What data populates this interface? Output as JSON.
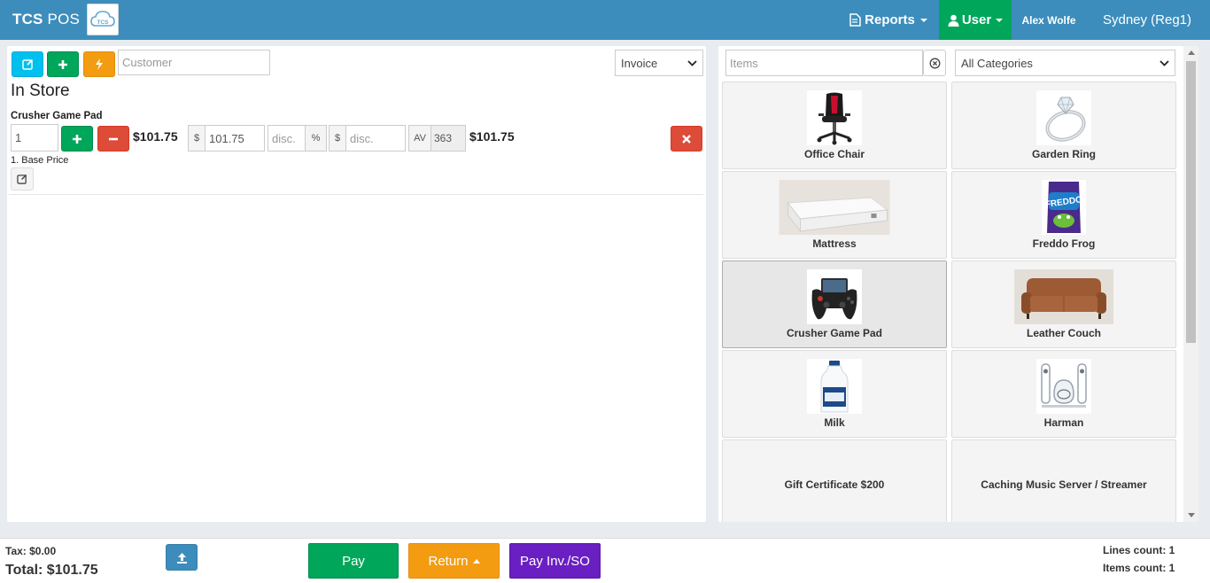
{
  "header": {
    "brand": "TCS",
    "brand_suffix": "POS",
    "logo_text": "TCS",
    "reports_label": "Reports",
    "user_label": "User",
    "user_name": "Alex Wolfe",
    "location": "Sydney (Reg1)"
  },
  "order": {
    "customer_placeholder": "Customer",
    "doc_type": "Invoice",
    "store_title": "In Store",
    "line": {
      "product_name": "Crusher Game Pad",
      "qty": "1",
      "unit_price": "$101.75",
      "currency_symbol": "$",
      "price_value": "101.75",
      "disc_placeholder": "disc.",
      "percent_symbol": "%",
      "currency_symbol2": "$",
      "disc2_placeholder": "disc.",
      "av_label": "AV",
      "av_value": "363",
      "line_total": "$101.75",
      "base_price_label": "1. Base Price"
    }
  },
  "catalog": {
    "search_placeholder": "Items",
    "category": "All Categories",
    "tiles": [
      {
        "label": "Office Chair",
        "icon": "office-chair-image"
      },
      {
        "label": "Garden Ring",
        "icon": "ring-image"
      },
      {
        "label": "Mattress",
        "icon": "mattress-image"
      },
      {
        "label": "Freddo Frog",
        "icon": "freddo-image"
      },
      {
        "label": "Crusher Game Pad",
        "icon": "gamepad-image"
      },
      {
        "label": "Leather Couch",
        "icon": "couch-image"
      },
      {
        "label": "Milk",
        "icon": "milk-image"
      },
      {
        "label": "Harman",
        "icon": "speaker-image"
      },
      {
        "label": "Gift Certificate $200"
      },
      {
        "label": "Caching Music Server / Streamer"
      }
    ]
  },
  "footer": {
    "tax": "Tax: $0.00",
    "total": "Total: $101.75",
    "pay_label": "Pay",
    "return_label": "Return",
    "pay_inv_label": "Pay Inv./SO",
    "lines_count": "Lines count: 1",
    "items_count": "Items count: 1"
  },
  "colors": {
    "header_blue": "#3c8dbc",
    "green": "#00a65a",
    "orange": "#f39c12",
    "purple": "#6a1fc2",
    "red": "#dd4b39",
    "cyan": "#00c0ef"
  }
}
